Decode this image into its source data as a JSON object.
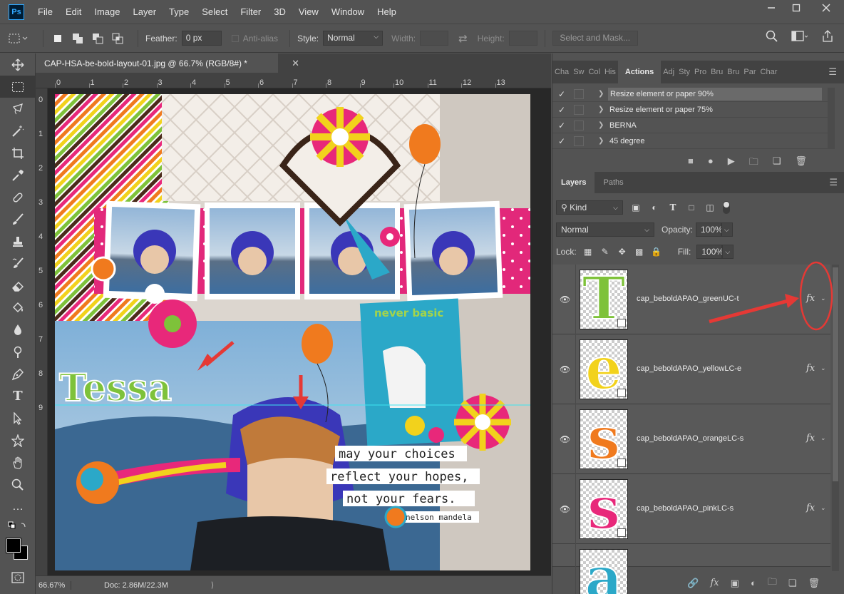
{
  "menubar": {
    "logo": "Ps",
    "items": [
      "File",
      "Edit",
      "Image",
      "Layer",
      "Type",
      "Select",
      "Filter",
      "3D",
      "View",
      "Window",
      "Help"
    ]
  },
  "options": {
    "feather_label": "Feather:",
    "feather_value": "0 px",
    "antialias_label": "Anti-alias",
    "style_label": "Style:",
    "style_value": "Normal",
    "width_label": "Width:",
    "height_label": "Height:",
    "select_mask": "Select and Mask..."
  },
  "document": {
    "tab_title": "CAP-HSA-be-bold-layout-01.jpg @ 66.7% (RGB/8#) *",
    "ruler_top": [
      "0",
      "1",
      "2",
      "3",
      "4",
      "5",
      "6",
      "7",
      "8",
      "9",
      "10",
      "11",
      "12",
      "13"
    ],
    "ruler_left": [
      "0",
      "1",
      "2",
      "3",
      "4",
      "5",
      "6",
      "7",
      "8",
      "9"
    ]
  },
  "artwork": {
    "name_title": "Tessa",
    "tag_text": "never basic",
    "quote_lines": [
      "may your choices",
      "reflect your hopes,",
      "not your fears."
    ],
    "quote_author": "nelson mandela"
  },
  "status": {
    "zoom": "66.67%",
    "doc": "Doc: 2.86M/22.3M"
  },
  "actions_panel": {
    "tabs": [
      "Cha",
      "Sw",
      "Col",
      "His",
      "Actions",
      "Adj",
      "Sty",
      "Pro",
      "Bru",
      "Bru",
      "Par",
      "Char"
    ],
    "active_tab": "Actions",
    "rows": [
      {
        "name": "Resize element or paper 90%",
        "selected": true
      },
      {
        "name": "Resize element or paper 75%",
        "selected": false
      },
      {
        "name": "BERNA",
        "selected": false
      },
      {
        "name": "45 degree",
        "selected": false
      }
    ]
  },
  "layers_panel": {
    "tabs": [
      "Layers",
      "Paths"
    ],
    "kind_label": "Kind",
    "blend_mode": "Normal",
    "opacity_label": "Opacity:",
    "opacity_value": "100%",
    "lock_label": "Lock:",
    "fill_label": "Fill:",
    "fill_value": "100%",
    "fx_label": "fx",
    "layers": [
      {
        "name": "cap_beboldAPAO_greenUC-t",
        "glyph": "T",
        "color": "#7ec23a"
      },
      {
        "name": "cap_beboldAPAO_yellowLC-e",
        "glyph": "e",
        "color": "#f2d21c"
      },
      {
        "name": "cap_beboldAPAO_orangeLC-s",
        "glyph": "s",
        "color": "#f07a1e"
      },
      {
        "name": "cap_beboldAPAO_pinkLC-s",
        "glyph": "s",
        "color": "#e8287a"
      },
      {
        "name": "",
        "glyph": "a",
        "color": "#2ba8c8"
      }
    ]
  },
  "colors": {
    "ui_bg": "#535353",
    "dark_bg": "#424242",
    "annotation_red": "#e53935"
  }
}
